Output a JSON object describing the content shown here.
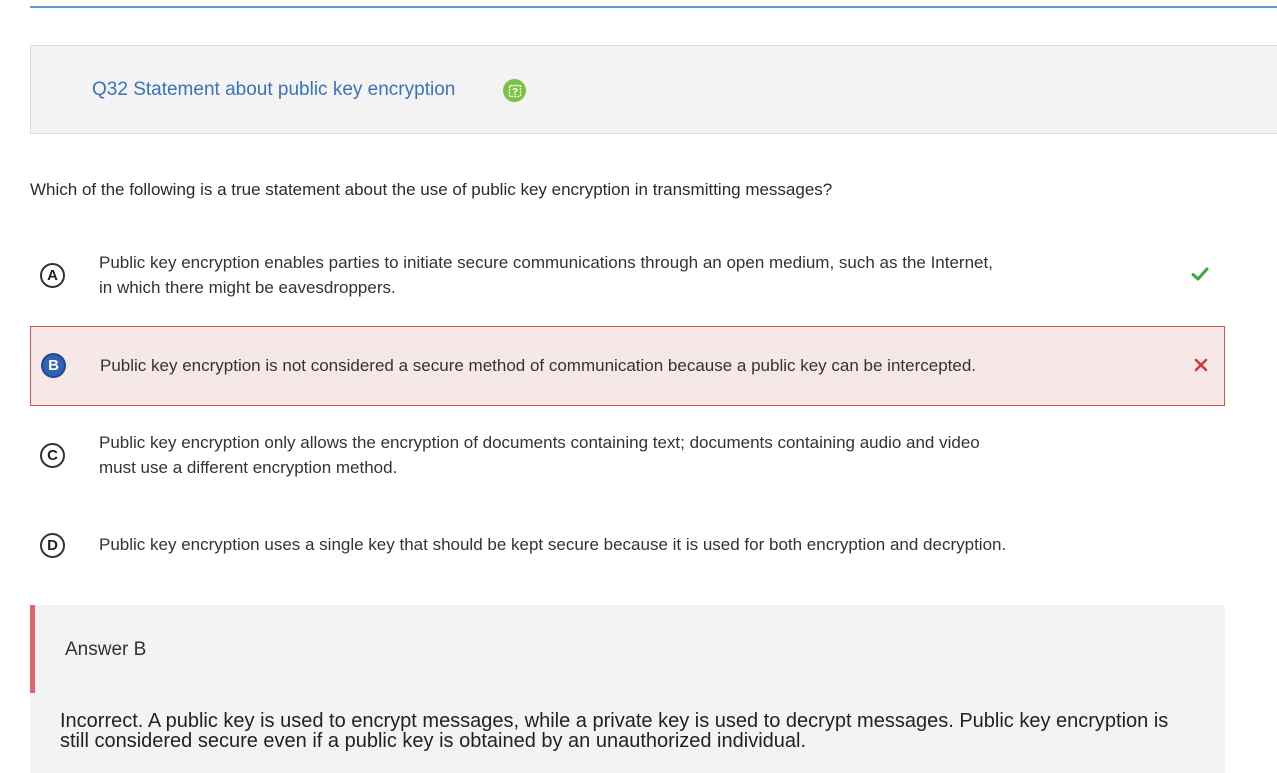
{
  "question": {
    "title": "Q32 Statement about public key encryption",
    "help_icon": "help-icon",
    "prompt": "Which of the following is a true statement about the use of public key encryption in transmitting messages?"
  },
  "options": [
    {
      "letter": "A",
      "line1": "Public key encryption enables parties to initiate secure communications through an open medium, such as the Internet,",
      "line2": "in which there might be eavesdroppers.",
      "mark": "check-icon",
      "mark_color": "#3aa935"
    },
    {
      "letter": "B",
      "line1": "Public key encryption is not considered a secure method of communication because a public key can be intercepted.",
      "line2": "",
      "mark": "x-icon",
      "mark_color": "#d03a3a",
      "selected": true
    },
    {
      "letter": "C",
      "line1": "Public key encryption only allows the encryption of documents containing text; documents containing audio and video",
      "line2": "must use a different encryption method."
    },
    {
      "letter": "D",
      "line1": "Public key encryption uses a single key that should be kept secure because it is used for both encryption and decryption.",
      "line2": ""
    }
  ],
  "answer": {
    "title": "Answer B",
    "explanation": "Incorrect. A public key is used to encrypt messages, while a private key is used to decrypt messages. Public key encryption is still considered secure even if a public key is obtained by an unauthorized individual."
  },
  "colors": {
    "title_blue": "#3b73b9",
    "help_green": "#7cc242",
    "wrong_border": "#d9534f",
    "wrong_bg": "#f7e8e8",
    "answer_bar": "#e06570"
  }
}
